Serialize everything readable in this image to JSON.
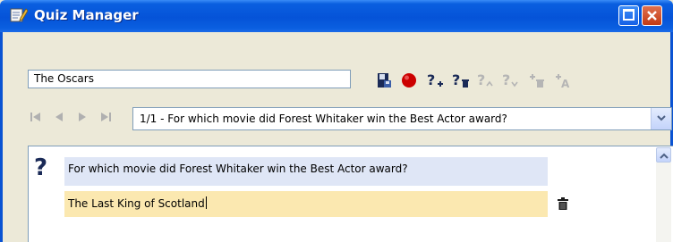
{
  "window": {
    "title": "Quiz Manager",
    "icon": "notepad-pencil-icon",
    "controls": [
      "maximize-icon",
      "close-icon"
    ]
  },
  "quiz": {
    "name_value": "The Oscars"
  },
  "toolbar": {
    "items": [
      {
        "name": "save-icon"
      },
      {
        "name": "record-icon"
      },
      {
        "name": "add-question-icon"
      },
      {
        "name": "delete-question-icon"
      },
      {
        "name": "move-question-up-icon"
      },
      {
        "name": "move-question-down-icon"
      },
      {
        "name": "delete-answer-icon"
      },
      {
        "name": "add-answer-icon"
      }
    ],
    "colors": {
      "record": "#cc0000",
      "icon_dark": "#1a2a57",
      "disabled": "#b5b5b5"
    }
  },
  "navigation": {
    "buttons": [
      "first-icon",
      "previous-icon",
      "next-icon",
      "last-icon"
    ],
    "selected_question": "1/1 - For which movie did Forest Whitaker win the Best Actor award?"
  },
  "editor": {
    "question_text": "For which movie did Forest Whitaker win the Best Actor award?",
    "answer_text": "The Last King of Scotland",
    "colors": {
      "question_bg": "#dfe6f6",
      "answer_bg": "#fbe8b0"
    }
  }
}
